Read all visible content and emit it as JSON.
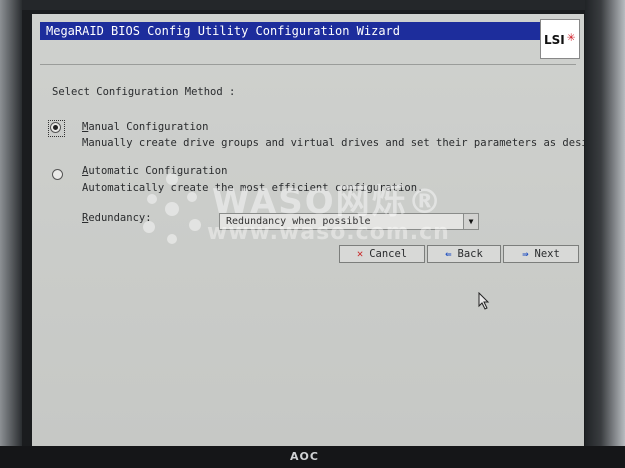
{
  "window": {
    "title": "MegaRAID BIOS Config Utility  Configuration Wizard",
    "logo_text": "LSI"
  },
  "prompt": "Select Configuration Method :",
  "options": [
    {
      "label": "Manual Configuration",
      "description": "Manually create drive groups and virtual drives and set their parameters as desired.",
      "selected": true
    },
    {
      "label": "Automatic Configuration",
      "description": "Automatically create the most efficient configuration.",
      "selected": false
    }
  ],
  "redundancy": {
    "label": "Redundancy:",
    "value": "Redundancy when possible"
  },
  "buttons": {
    "cancel": "Cancel",
    "back": "Back",
    "next": "Next"
  },
  "icons": {
    "cancel": "close-x-icon",
    "back": "arrow-left-icon",
    "next": "arrow-right-icon",
    "dropdown": "triangle-down-icon"
  },
  "watermark": {
    "brand": "WASO网烁®",
    "url": "www.waso.com.cn"
  },
  "monitor_brand": "AOC"
}
